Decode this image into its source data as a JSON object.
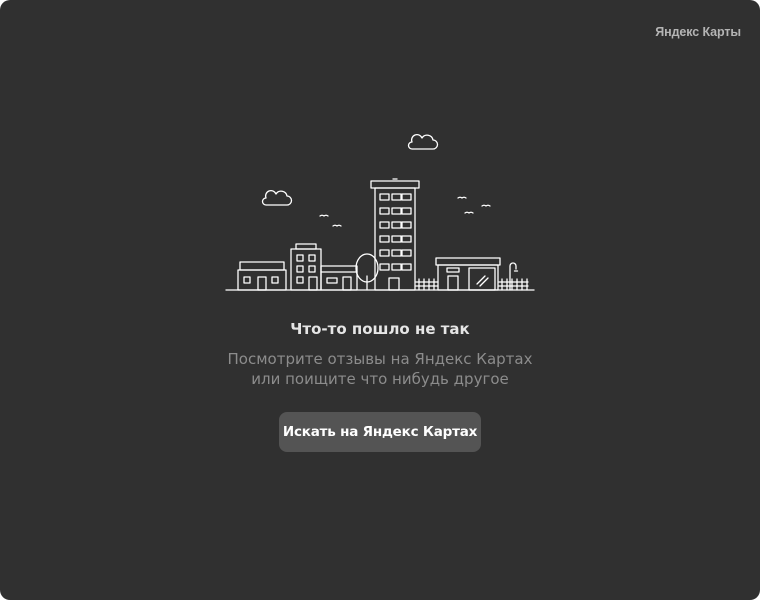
{
  "header": {
    "logo_text": "Яндекс Карты"
  },
  "error": {
    "title": "Что-то пошло не так",
    "subtitle_line1": "Посмотрите отзывы на Яндекс Картах",
    "subtitle_line2": "или поищите что нибудь другое",
    "button_label": "Искать на Яндекс Картах",
    "illustration": "city-skyline-illustration"
  },
  "colors": {
    "background": "#303030",
    "button_background": "#545454",
    "title": "#e6e6e6",
    "subtitle": "#8c8c8c",
    "logo": "#b4b4b4",
    "illustration_stroke": "#ffffff"
  }
}
